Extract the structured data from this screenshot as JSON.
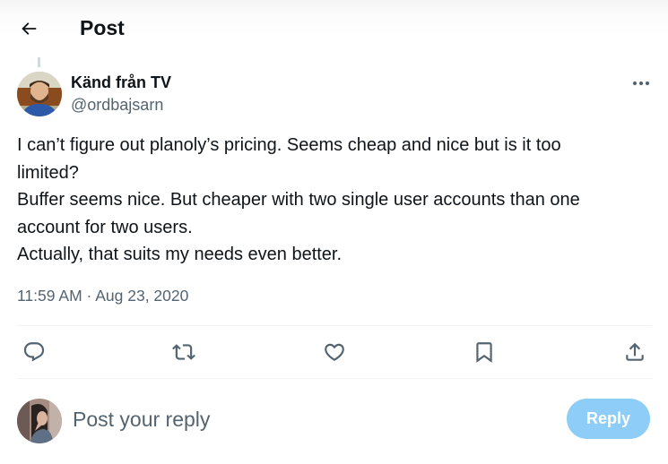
{
  "header": {
    "back_icon": "arrow-left-icon",
    "title": "Post"
  },
  "tweet": {
    "author": {
      "display_name": "Känd från TV",
      "handle": "@ordbajsarn",
      "avatar": "bearded-man-photo"
    },
    "more_icon": "more-horizontal-icon",
    "text_lines": [
      "I can’t figure out planoly’s pricing. Seems cheap and nice but is it too",
      "limited?",
      "Buffer seems nice. But cheaper with two single user accounts than one",
      "account for two users.",
      "Actually, that suits my needs even better."
    ],
    "timestamp": "11:59 AM · Aug 23, 2020",
    "actions": [
      {
        "name": "reply",
        "icon": "reply-bubble-icon"
      },
      {
        "name": "repost",
        "icon": "repost-icon"
      },
      {
        "name": "like",
        "icon": "heart-icon"
      },
      {
        "name": "bookmark",
        "icon": "bookmark-icon"
      },
      {
        "name": "share",
        "icon": "share-icon"
      }
    ]
  },
  "composer": {
    "avatar": "user-photo",
    "placeholder": "Post your reply",
    "value": "",
    "reply_button_label": "Reply",
    "reply_button_color": "#8ecdf8"
  },
  "colors": {
    "text_primary": "#0f1419",
    "text_secondary": "#536471",
    "icon": "#536471",
    "divider": "#eff3f4"
  }
}
